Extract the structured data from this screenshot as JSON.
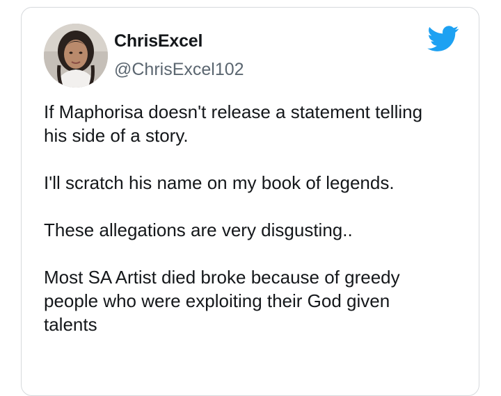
{
  "tweet": {
    "author": {
      "display_name": "ChrisExcel",
      "handle": "@ChrisExcel102",
      "avatar_icon": "profile-photo"
    },
    "platform_icon": "twitter-bird-icon",
    "brand_color": "#1da1f2",
    "paragraphs": [
      [
        "If Maphorisa doesn't release a statement telling",
        "his side of a story."
      ],
      [
        "I'll scratch his name on my book of legends."
      ],
      [
        "These allegations are very disgusting.."
      ],
      [
        "Most SA Artist died broke because of greedy",
        "people who were exploiting their God given",
        "talents"
      ]
    ]
  }
}
